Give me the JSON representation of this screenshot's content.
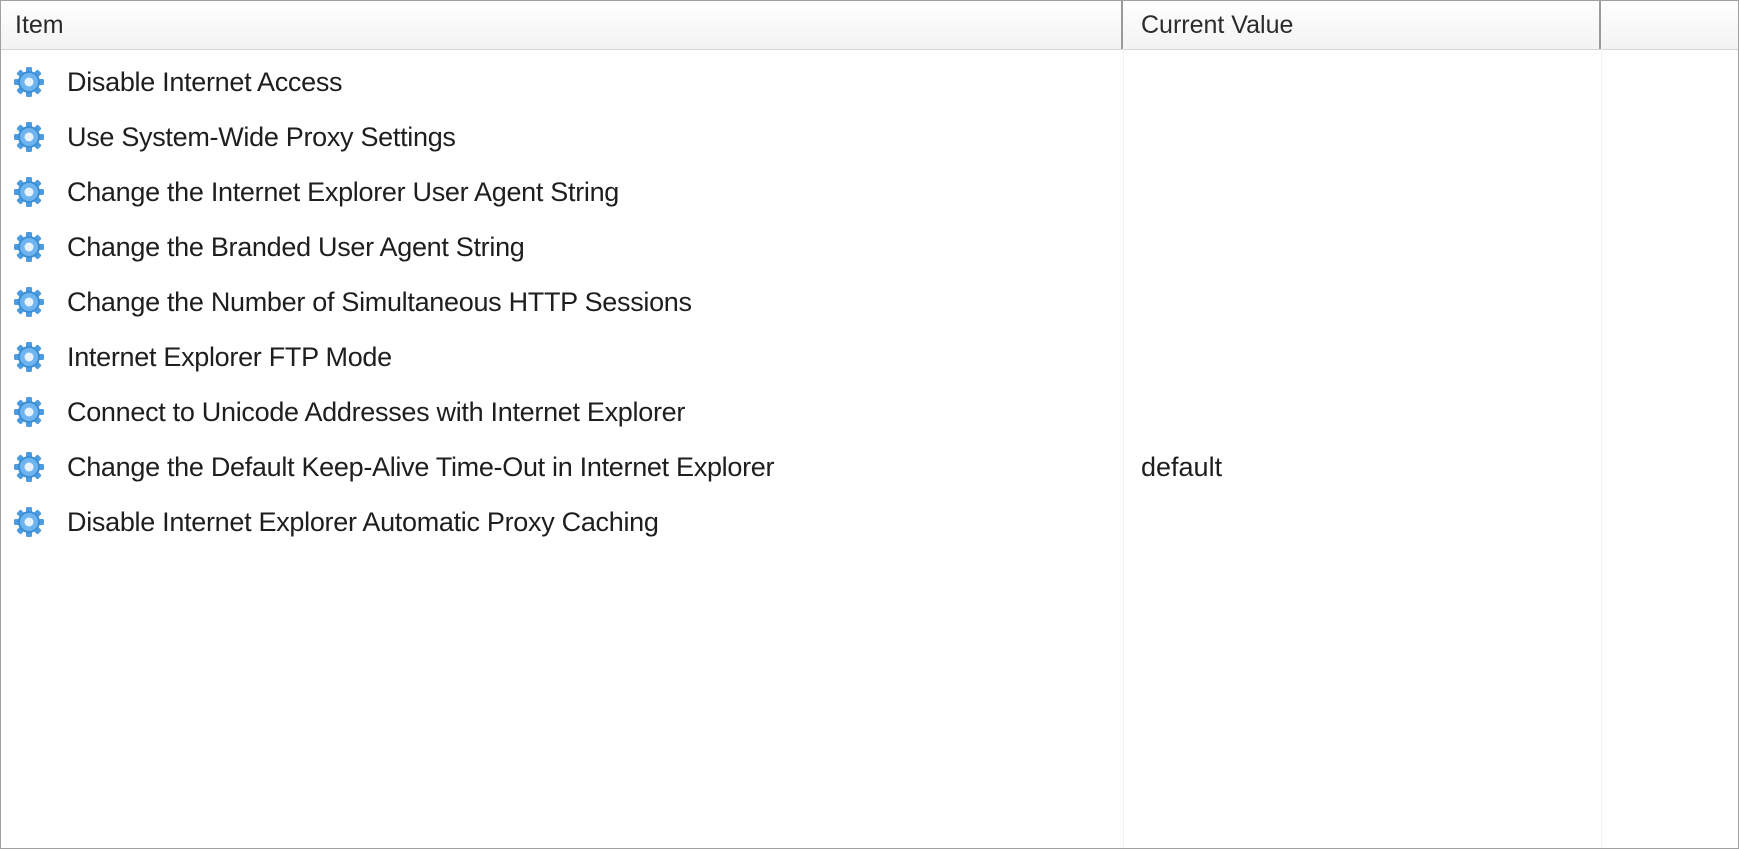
{
  "columns": {
    "item": "Item",
    "current_value": "Current Value",
    "extra": ""
  },
  "icon": "gear-icon",
  "accent_color": "#3a8fd6",
  "rows": [
    {
      "label": "Disable Internet Access",
      "value": ""
    },
    {
      "label": "Use System-Wide Proxy Settings",
      "value": ""
    },
    {
      "label": "Change the Internet Explorer User Agent String",
      "value": ""
    },
    {
      "label": "Change the Branded User Agent String",
      "value": ""
    },
    {
      "label": "Change the Number of Simultaneous HTTP Sessions",
      "value": ""
    },
    {
      "label": "Internet Explorer FTP Mode",
      "value": ""
    },
    {
      "label": "Connect to Unicode Addresses with Internet Explorer",
      "value": ""
    },
    {
      "label": "Change the Default Keep-Alive Time-Out in Internet Explorer",
      "value": "default"
    },
    {
      "label": "Disable Internet Explorer Automatic Proxy Caching",
      "value": ""
    }
  ]
}
